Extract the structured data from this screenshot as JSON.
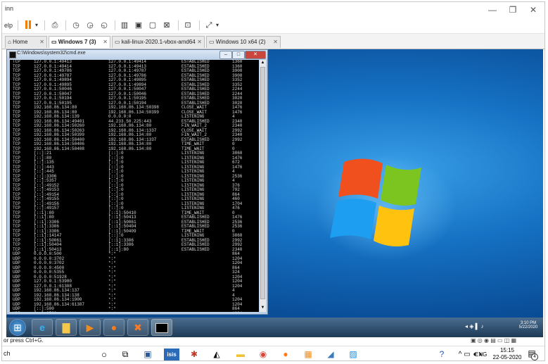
{
  "host": {
    "title": "inn",
    "toolbar_help": "elp",
    "minimize": "—",
    "restore": "❐",
    "close": "✕"
  },
  "tabs": [
    {
      "label": "Home"
    },
    {
      "label": "Windows 7 (3)"
    },
    {
      "label": "kali-linux-2020.1-vbox-amd64"
    },
    {
      "label": "Windows 10 x64 (2)"
    }
  ],
  "cmd": {
    "title": "C:\\Windows\\system32\\cmd.exe",
    "rows": [
      [
        "TCP",
        "127.0.0.1:49413",
        "127.0.0.1:49414",
        "ESTABLISHED",
        "1360"
      ],
      [
        "TCP",
        "127.0.0.1:49414",
        "127.0.0.1:49413",
        "ESTABLISHED",
        "1360"
      ],
      [
        "TCP",
        "127.0.0.1:49786",
        "127.0.0.1:49787",
        "ESTABLISHED",
        "3908"
      ],
      [
        "TCP",
        "127.0.0.1:49787",
        "127.0.0.1:49786",
        "ESTABLISHED",
        "3908"
      ],
      [
        "TCP",
        "127.0.0.1:49894",
        "127.0.0.1:49895",
        "ESTABLISHED",
        "3352"
      ],
      [
        "TCP",
        "127.0.0.1:49895",
        "127.0.0.1:49894",
        "ESTABLISHED",
        "3352"
      ],
      [
        "TCP",
        "127.0.0.1:50046",
        "127.0.0.1:50047",
        "ESTABLISHED",
        "2244"
      ],
      [
        "TCP",
        "127.0.0.1:50047",
        "127.0.0.1:50046",
        "ESTABLISHED",
        "2244"
      ],
      [
        "TCP",
        "127.0.0.1:50194",
        "127.0.0.1:50195",
        "ESTABLISHED",
        "3020"
      ],
      [
        "TCP",
        "127.0.0.1:50195",
        "127.0.0.1:50194",
        "ESTABLISHED",
        "3020"
      ],
      [
        "TCP",
        "192.168.86.134:80",
        "192.168.86.134:50398",
        "CLOSE_WAIT",
        "1476"
      ],
      [
        "TCP",
        "192.168.86.134:80",
        "192.168.86.134:50399",
        "CLOSE_WAIT",
        "1476"
      ],
      [
        "TCP",
        "192.168.86.134:139",
        "0.0.0.0:0",
        "LISTENING",
        "4"
      ],
      [
        "TCP",
        "192.168.86.134:49401",
        "44.233.50.225:443",
        "ESTABLISHED",
        "2340"
      ],
      [
        "TCP",
        "192.168.86.134:50260",
        "192.168.86.134:80",
        "FIN_WAIT_2",
        "2340"
      ],
      [
        "TCP",
        "192.168.86.134:50263",
        "192.168.86.134:1337",
        "CLOSE_WAIT",
        "2992"
      ],
      [
        "TCP",
        "192.168.86.134:50399",
        "192.168.86.134:80",
        "FIN_WAIT_2",
        "2340"
      ],
      [
        "TCP",
        "192.168.86.134:50400",
        "192.168.86.134:1337",
        "ESTABLISHED",
        "2992"
      ],
      [
        "TCP",
        "192.168.86.134:50406",
        "192.168.86.134:80",
        "TIME_WAIT",
        "0"
      ],
      [
        "TCP",
        "192.168.86.134:50408",
        "192.168.86.134:80",
        "TIME_WAIT",
        "0"
      ],
      [
        "TCP",
        "[::]:21",
        "[::]:0",
        "LISTENING",
        "3868"
      ],
      [
        "TCP",
        "[::]:80",
        "[::]:0",
        "LISTENING",
        "1476"
      ],
      [
        "TCP",
        "[::]:135",
        "[::]:0",
        "LISTENING",
        "672"
      ],
      [
        "TCP",
        "[::]:443",
        "[::]:0",
        "LISTENING",
        "1476"
      ],
      [
        "TCP",
        "[::]:445",
        "[::]:0",
        "LISTENING",
        "4"
      ],
      [
        "TCP",
        "[::]:3306",
        "[::]:0",
        "LISTENING",
        "2536"
      ],
      [
        "TCP",
        "[::]:5357",
        "[::]:0",
        "LISTENING",
        "4"
      ],
      [
        "TCP",
        "[::]:49152",
        "[::]:0",
        "LISTENING",
        "376"
      ],
      [
        "TCP",
        "[::]:49153",
        "[::]:0",
        "LISTENING",
        "792"
      ],
      [
        "TCP",
        "[::]:49154",
        "[::]:0",
        "LISTENING",
        "864"
      ],
      [
        "TCP",
        "[::]:49155",
        "[::]:0",
        "LISTENING",
        "460"
      ],
      [
        "TCP",
        "[::]:49156",
        "[::]:0",
        "LISTENING",
        "1704"
      ],
      [
        "TCP",
        "[::]:49157",
        "[::]:0",
        "LISTENING",
        "476"
      ],
      [
        "TCP",
        "[::1]:80",
        "[::1]:50410",
        "TIME_WAIT",
        "0"
      ],
      [
        "TCP",
        "[::1]:80",
        "[::1]:50413",
        "ESTABLISHED",
        "1476"
      ],
      [
        "TCP",
        "[::1]:3306",
        "[::1]:50061",
        "ESTABLISHED",
        "2536"
      ],
      [
        "TCP",
        "[::1]:3306",
        "[::1]:50404",
        "ESTABLISHED",
        "2536"
      ],
      [
        "TCP",
        "[::1]:3306",
        "[::1]:50409",
        "TIME_WAIT",
        "0"
      ],
      [
        "TCP",
        "[::1]:14147",
        "[::]:0",
        "LISTENING",
        "3868"
      ],
      [
        "TCP",
        "[::1]:50061",
        "[::1]:3306",
        "ESTABLISHED",
        "2992"
      ],
      [
        "TCP",
        "[::1]:50404",
        "[::1]:3306",
        "ESTABLISHED",
        "2992"
      ],
      [
        "TCP",
        "[::1]:50413",
        "[::1]:80",
        "ESTABLISHED",
        "2340"
      ],
      [
        "UDP",
        "0.0.0.0:500",
        "*:*",
        "",
        "864"
      ],
      [
        "UDP",
        "0.0.0.0:3702",
        "*:*",
        "",
        "1204"
      ],
      [
        "UDP",
        "0.0.0.0:3702",
        "*:*",
        "",
        "1204"
      ],
      [
        "UDP",
        "0.0.0.0:4500",
        "*:*",
        "",
        "864"
      ],
      [
        "UDP",
        "0.0.0.0:5355",
        "*:*",
        "",
        "324"
      ],
      [
        "UDP",
        "0.0.0.0:51928",
        "*:*",
        "",
        "1204"
      ],
      [
        "UDP",
        "127.0.0.1:53980",
        "*:*",
        "",
        "1204"
      ],
      [
        "UDP",
        "127.0.0.1:61308",
        "*:*",
        "",
        "1204"
      ],
      [
        "UDP",
        "192.168.86.134:137",
        "*:*",
        "",
        "4"
      ],
      [
        "UDP",
        "192.168.86.134:138",
        "*:*",
        "",
        "4"
      ],
      [
        "UDP",
        "192.168.86.134:1900",
        "*:*",
        "",
        "1204"
      ],
      [
        "UDP",
        "192.168.86.134:61387",
        "*:*",
        "",
        "1204"
      ],
      [
        "UDP",
        "[::]:500",
        "*:*",
        "",
        "864"
      ],
      [
        "UDP",
        "[::]:3702",
        "*:*",
        "",
        "1204"
      ]
    ]
  },
  "w7tray": {
    "time": "3:10 PM",
    "date": "5/22/2020"
  },
  "status_text": "or press Ctrl+G.",
  "win10": {
    "search": "ch",
    "lang": "ENG",
    "time": "15:15",
    "date": "22-05-2020",
    "notif_count": "4"
  }
}
